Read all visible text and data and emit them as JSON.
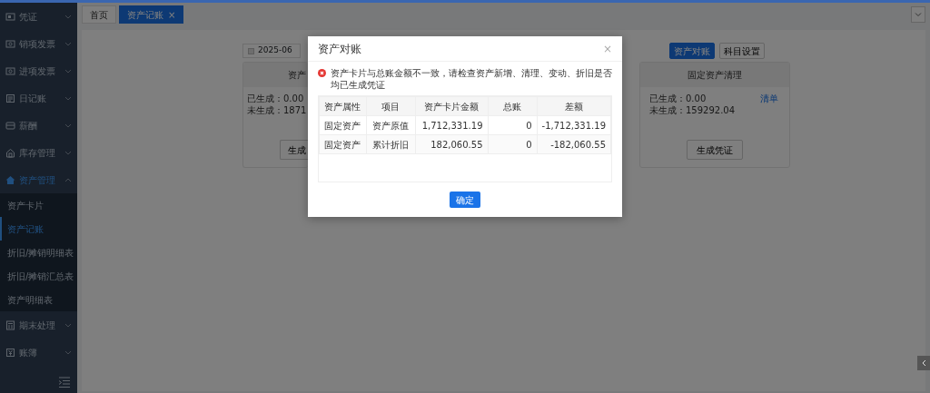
{
  "sidebar": {
    "items": [
      {
        "label": "凭证",
        "expanded": false,
        "selected": false
      },
      {
        "label": "销项发票",
        "expanded": false,
        "selected": false
      },
      {
        "label": "进项发票",
        "expanded": false,
        "selected": false
      },
      {
        "label": "日记账",
        "expanded": false,
        "selected": false
      },
      {
        "label": "薪酬",
        "expanded": false,
        "selected": false
      },
      {
        "label": "库存管理",
        "expanded": false,
        "selected": false
      },
      {
        "label": "资产管理",
        "expanded": true,
        "selected": true,
        "children": [
          {
            "label": "资产卡片",
            "selected": false
          },
          {
            "label": "资产记账",
            "selected": true
          },
          {
            "label": "折旧/摊销明细表",
            "selected": false
          },
          {
            "label": "折旧/摊销汇总表",
            "selected": false
          },
          {
            "label": "资产明细表",
            "selected": false
          }
        ]
      },
      {
        "label": "期末处理",
        "expanded": false,
        "selected": false
      },
      {
        "label": "账簿",
        "expanded": false,
        "selected": false
      }
    ]
  },
  "tabs": [
    {
      "label": "首页",
      "selected": false,
      "closable": false
    },
    {
      "label": "资产记账",
      "selected": true,
      "closable": true,
      "close": "×"
    }
  ],
  "toolbar": {
    "date": "2025-06",
    "buttons": [
      {
        "label": "资产对账",
        "primary": true
      },
      {
        "label": "科目设置",
        "primary": false
      }
    ]
  },
  "cards": [
    {
      "title": "资产",
      "generated": "已生成：0.00",
      "pending": "未生成：1871",
      "button": "生成"
    },
    {
      "title": "固定资产清理",
      "generated": "已生成：0.00",
      "pending": "未生成：159292.04",
      "link": "清单",
      "button": "生成凭证"
    }
  ],
  "dialog": {
    "title": "资产对账",
    "close": "×",
    "message": "资产卡片与总账金额不一致，请检查资产新增、清理、变动、折旧是否均已生成凭证",
    "table": {
      "columns": [
        "资产属性",
        "项目",
        "资产卡片金额",
        "总账",
        "差额"
      ],
      "rows": [
        [
          "固定资产",
          "资产原值",
          "1,712,331.19",
          "0",
          "-1,712,331.19"
        ],
        [
          "固定资产",
          "累计折旧",
          "182,060.55",
          "0",
          "-182,060.55"
        ]
      ]
    },
    "confirm": "确定"
  }
}
